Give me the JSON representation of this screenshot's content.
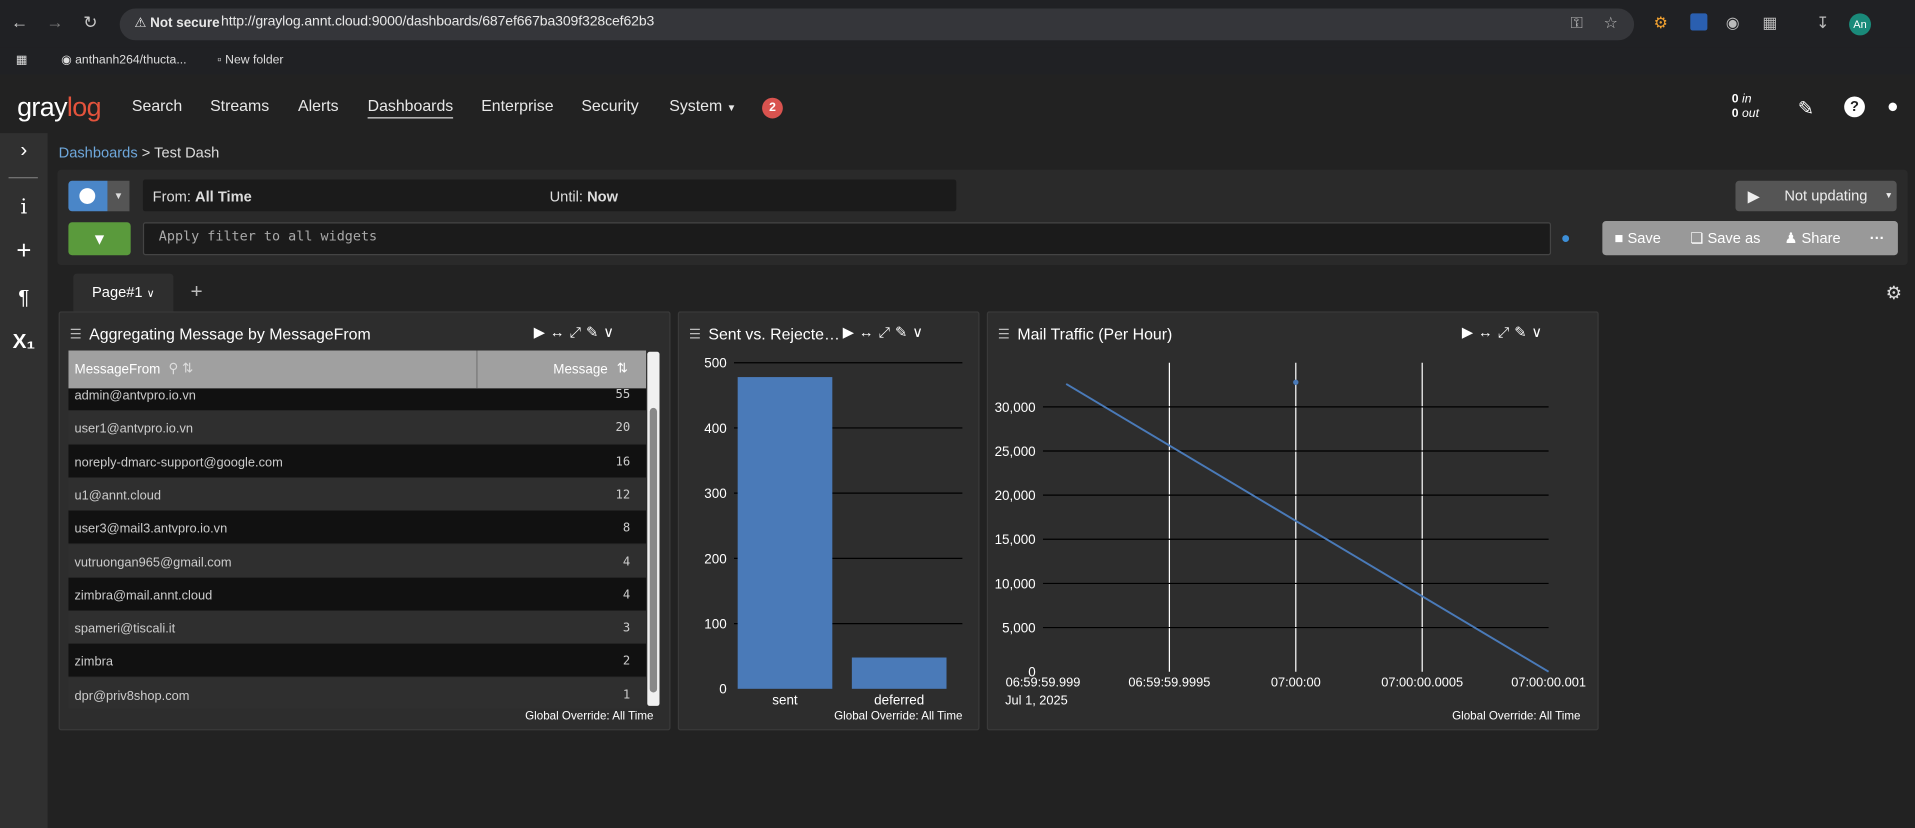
{
  "browser": {
    "not_secure": "Not secure",
    "url": "http://graylog.annt.cloud:9000/dashboards/687ef667ba309f328cef62b3",
    "bookmarks": [
      "anthanh264/thucta...",
      "New folder"
    ],
    "profile": "An"
  },
  "navbar": {
    "logo_a": "gray",
    "logo_b": "log",
    "items": [
      "Search",
      "Streams",
      "Alerts",
      "Dashboards",
      "Enterprise",
      "Security",
      "System"
    ],
    "notification_count": "2",
    "throughput_in": "0",
    "throughput_in_label": "in",
    "throughput_out": "0",
    "throughput_out_label": "out"
  },
  "breadcrumb": {
    "parent": "Dashboards",
    "sep": ">",
    "current": "Test Dash"
  },
  "search": {
    "from_label": "From:",
    "from_value": "All Time",
    "until_label": "Until:",
    "until_value": "Now",
    "filter_placeholder": "Apply filter to all widgets",
    "refresh": "Not updating",
    "save": "Save",
    "save_as": "Save as",
    "share": "Share",
    "more": "···"
  },
  "tabs": {
    "page1": "Page#1",
    "add": "+"
  },
  "widgets": {
    "w1": {
      "title": "Aggregating Message by MessageFrom",
      "col1": "MessageFrom",
      "col2": "Message",
      "rows": [
        {
          "from": "admin@antvpro.io.vn",
          "count": "55"
        },
        {
          "from": "user1@antvpro.io.vn",
          "count": "20"
        },
        {
          "from": "noreply-dmarc-support@google.com",
          "count": "16"
        },
        {
          "from": "u1@annt.cloud",
          "count": "12"
        },
        {
          "from": "user3@mail3.antvpro.io.vn",
          "count": "8"
        },
        {
          "from": "vutruongan965@gmail.com",
          "count": "4"
        },
        {
          "from": "zimbra@mail.annt.cloud",
          "count": "4"
        },
        {
          "from": "spameri@tiscali.it",
          "count": "3"
        },
        {
          "from": "zimbra",
          "count": "2"
        },
        {
          "from": "dpr@priv8shop.com",
          "count": "1"
        }
      ],
      "override": "Global Override: All Time"
    },
    "w2": {
      "title": "Sent vs. Rejecte…",
      "override": "Global Override: All Time"
    },
    "w3": {
      "title": "Mail Traffic (Per Hour)",
      "override": "Global Override: All Time"
    }
  },
  "chart_data": [
    {
      "type": "bar",
      "categories": [
        "sent",
        "deferred"
      ],
      "values": [
        478,
        48
      ],
      "yticks": [
        "0",
        "100",
        "200",
        "300",
        "400",
        "500"
      ],
      "ylim": [
        0,
        500
      ],
      "color": "#4a7ab8"
    },
    {
      "type": "line",
      "x": [
        "06:59:59.999",
        "07:00:00.001"
      ],
      "y": [
        32600,
        0
      ],
      "xticks": [
        "06:59:59.999",
        "06:59:59.9995",
        "07:00:00",
        "07:00:00.0005",
        "07:00:00.001"
      ],
      "xdate": "Jul 1, 2025",
      "yticks": [
        "0",
        "5,000",
        "10,000",
        "15,000",
        "20,000",
        "25,000",
        "30,000"
      ],
      "ylim": [
        0,
        35000
      ],
      "color": "#4a7ab8"
    }
  ]
}
